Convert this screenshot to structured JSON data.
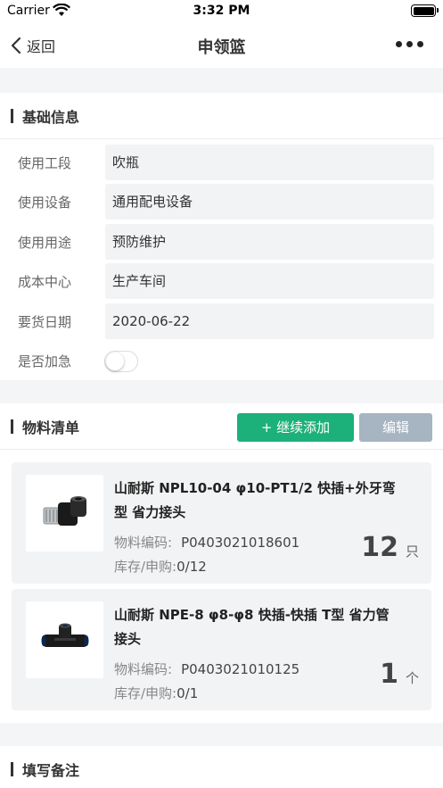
{
  "status_bar": {
    "carrier": "Carrier",
    "time": "3:32 PM"
  },
  "nav": {
    "back_label": "返回",
    "title": "申领篮"
  },
  "basic_info": {
    "title": "基础信息",
    "fields": [
      {
        "label": "使用工段",
        "value": "吹瓶"
      },
      {
        "label": "使用设备",
        "value": "通用配电设备"
      },
      {
        "label": "使用用途",
        "value": "预防维护"
      },
      {
        "label": "成本中心",
        "value": "生产车间"
      },
      {
        "label": "要货日期",
        "value": "2020-06-22"
      }
    ],
    "urgent": {
      "label": "是否加急",
      "on": false
    }
  },
  "materials": {
    "title": "物料清单",
    "add_label": "+ 继续添加",
    "edit_label": "编辑",
    "code_label": "物料编码:",
    "stock_label": "库存/申购:",
    "items": [
      {
        "name": "山耐斯 NPL10-04 φ10-PT1/2 快插+外牙弯型 省力接头",
        "code": "P0403021018601",
        "stock": "0/12",
        "qty": "12",
        "unit": "只",
        "icon": "elbow-fitting-icon"
      },
      {
        "name": "山耐斯 NPE-8 φ8-φ8 快插-快插 T型 省力管接头",
        "code": "P0403021010125",
        "stock": "0/1",
        "qty": "1",
        "unit": "个",
        "icon": "tee-fitting-icon"
      }
    ]
  },
  "remarks": {
    "title": "填写备注"
  },
  "colors": {
    "accent_green": "#1cb07a",
    "disabled_gray": "#a7b4c1",
    "background": "#f4f5f7"
  }
}
